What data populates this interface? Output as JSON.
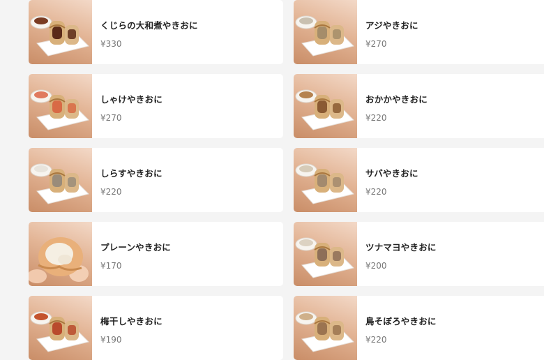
{
  "menu": {
    "items": [
      {
        "name": "くじらの大和煮やきおに",
        "price": "¥330",
        "side": "#7a3b22",
        "filling": "#5a2a18"
      },
      {
        "name": "アジやきおに",
        "price": "¥270",
        "side": "#c9c0b0",
        "filling": "#a58d6a"
      },
      {
        "name": "しゃけやきおに",
        "price": "¥270",
        "side": "#e07a5f",
        "filling": "#d86a45"
      },
      {
        "name": "おかかやきおに",
        "price": "¥220",
        "side": "#b5824f",
        "filling": "#8a5a33"
      },
      {
        "name": "しらすやきおに",
        "price": "¥220",
        "side": "#e8e4dc",
        "filling": "#9a8c7a"
      },
      {
        "name": "サバやきおに",
        "price": "¥220",
        "side": "#d6cbb8",
        "filling": "#a38a6e"
      },
      {
        "name": "プレーンやきおに",
        "price": "¥170",
        "side": "",
        "filling": "#e9b07a"
      },
      {
        "name": "ツナマヨやきおに",
        "price": "¥200",
        "side": "#dcd2c2",
        "filling": "#8e6f58"
      },
      {
        "name": "梅干しやきおに",
        "price": "¥190",
        "side": "#c4542e",
        "filling": "#b94a2c"
      },
      {
        "name": "鳥そぼろやきおに",
        "price": "¥220",
        "side": "#cfb08a",
        "filling": "#9b7450"
      }
    ]
  },
  "colors": {
    "background": "#f4f4f4",
    "card": "#ffffff",
    "name_text": "#222222",
    "price_text": "#777777"
  }
}
